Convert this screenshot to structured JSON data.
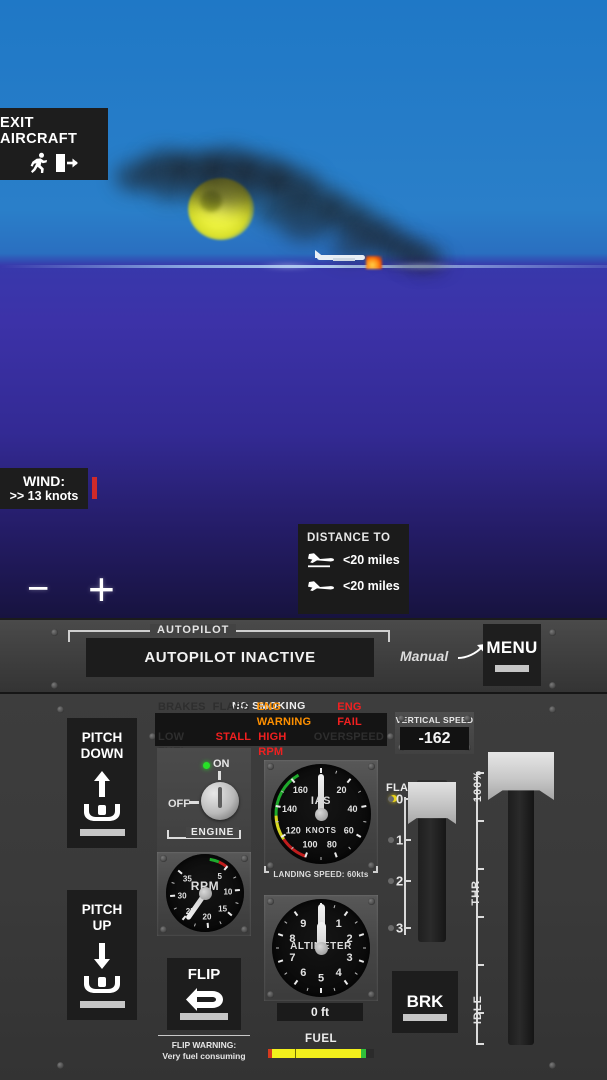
{
  "scene": {
    "exit_aircraft": {
      "label": "EXIT AIRCRAFT",
      "run_icon": "running-person-icon",
      "door_icon": "exit-door-icon"
    },
    "wind": {
      "title": "WIND:",
      "value": ">> 13 knots"
    },
    "zoom": {
      "out": "−",
      "in": "+"
    },
    "distance": {
      "title": "DISTANCE TO",
      "rows": [
        {
          "icon": "plane-landing-icon",
          "value": "<20 miles"
        },
        {
          "icon": "plane-takeoff-icon",
          "value": "<20 miles"
        }
      ]
    }
  },
  "autopilot": {
    "bracket_label": "AUTOPILOT",
    "status": "AUTOPILOT INACTIVE",
    "mode_label": "Manual",
    "arrow_icon": "curved-arrow-icon",
    "menu_label": "MENU"
  },
  "cockpit": {
    "no_smoking": "NO SMOKING",
    "warnings": [
      {
        "label": "BRAKES",
        "state": "off"
      },
      {
        "label": "FLAPS",
        "state": "off"
      },
      {
        "label": "ENG WARNING",
        "state": "amber"
      },
      {
        "label": "ENG FAIL",
        "state": "red"
      },
      {
        "label": "LOW FUEL",
        "state": "off"
      },
      {
        "label": "STALL",
        "state": "red"
      },
      {
        "label": "HIGH RPM",
        "state": "red"
      },
      {
        "label": "OVERSPEED",
        "state": "off"
      }
    ],
    "pitch_down": {
      "line1": "PITCH",
      "line2": "DOWN",
      "arrow_icon": "arrow-up-icon",
      "yoke_icon": "yoke-icon"
    },
    "pitch_up": {
      "line1": "PITCH",
      "line2": "UP",
      "arrow_icon": "arrow-down-icon",
      "yoke_icon": "yoke-icon"
    },
    "engine": {
      "on_label": "ON",
      "off_label": "OFF",
      "name": "ENGINE",
      "position": "ON"
    },
    "landing_speed": "LANDING SPEED: 60kts",
    "flip": {
      "label": "FLIP",
      "icon": "u-turn-arrow-icon",
      "warning_line1": "FLIP WARNING:",
      "warning_line2": "Very fuel consuming"
    },
    "altitude_readout": "0 ft",
    "fuel": {
      "label": "FUEL",
      "percent": 93
    },
    "flaps": {
      "label": "FLAPS",
      "positions": [
        "0",
        "1",
        "2",
        "3"
      ],
      "selected": "0"
    },
    "brake": {
      "label": "BRK"
    },
    "throttle": {
      "top_label": "100%",
      "mid_label": "THR",
      "bottom_label": "IDLE",
      "percent": 100
    },
    "vertical_speed": {
      "title": "VERTICAL SPEED",
      "value": "-162"
    }
  },
  "chart_data": [
    {
      "type": "gauge",
      "title": "IAS",
      "units": "KNOTS",
      "value": 0,
      "min": 0,
      "max": 160,
      "ticks": [
        0,
        20,
        40,
        60,
        80,
        100,
        120,
        140,
        160
      ],
      "arc_colors": {
        "red": "#c01d1d",
        "yellow": "#d8d820",
        "green": "#1faa2c"
      }
    },
    {
      "type": "gauge",
      "title": "RPM",
      "units": "",
      "value": 0,
      "min": 0,
      "max": 35,
      "ticks": [
        5,
        10,
        15,
        20,
        25,
        30,
        35
      ],
      "arc_colors": {
        "red": "#c01d1d",
        "green": "#1faa2c"
      }
    },
    {
      "type": "gauge",
      "title": "ALTIMETER",
      "units": "",
      "value": 0,
      "min": 0,
      "max": 10,
      "ticks": [
        0,
        1,
        2,
        3,
        4,
        5,
        6,
        7,
        8,
        9
      ]
    }
  ]
}
